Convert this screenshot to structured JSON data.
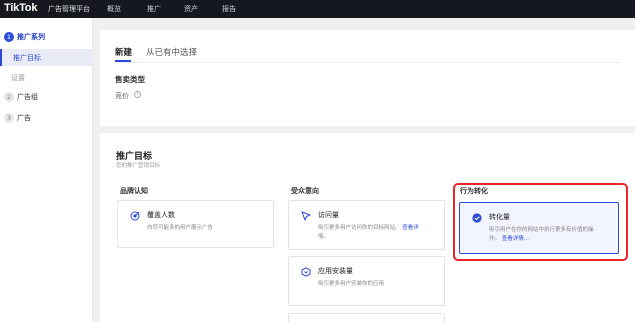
{
  "topbar": {
    "logo": "TikTok",
    "logo_sub": "广告管理平台",
    "nav": [
      "概览",
      "推广",
      "资产",
      "报告"
    ]
  },
  "sidebar": {
    "steps": [
      {
        "num": "1",
        "label": "推广系列"
      },
      {
        "num": "2",
        "label": "广告组"
      },
      {
        "num": "3",
        "label": "广告"
      }
    ],
    "subitems": [
      "推广目标",
      "设置"
    ]
  },
  "campaign": {
    "tab_new": "新建",
    "tab_existing": "从已有中选择",
    "sell_type_title": "售卖类型",
    "bid_label": "竞价",
    "info_glyph": "?"
  },
  "objective": {
    "title": "推广目标",
    "subtitle": "您的推广营销目标",
    "columns": [
      "品牌认知",
      "受众意向",
      "行为转化"
    ],
    "options": {
      "reach": {
        "title": "覆盖人数",
        "desc": "向尽可能多的用户展示广告"
      },
      "traffic": {
        "title": "访问量",
        "desc_l1": "吸引更多用户访问你的目标网站。",
        "link": "查看详",
        "desc_l2": "情。"
      },
      "app_install": {
        "title": "应用安装量",
        "desc": "吸引更多用户安装你的应用"
      },
      "conversions": {
        "title": "转化量",
        "desc_l1": "吸引用户在你的网站中执行更多有价值的操",
        "desc_l2": "作。",
        "link": "查看详情..."
      }
    }
  },
  "colors": {
    "brand": "#2d4bd6",
    "highlight": "#e8252a",
    "topbar": "#16181f"
  }
}
